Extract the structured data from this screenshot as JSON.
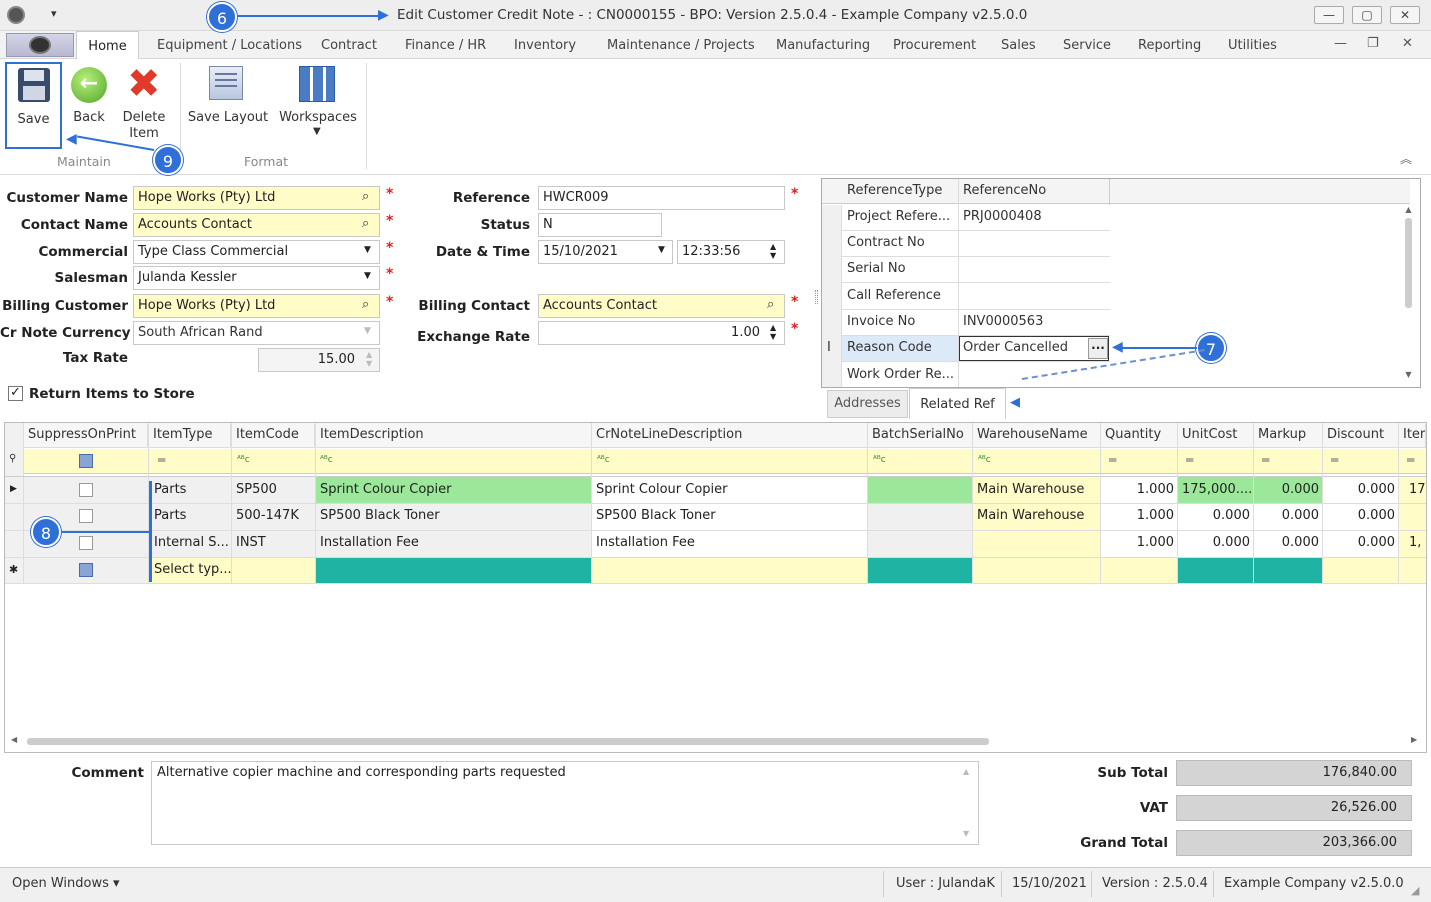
{
  "window": {
    "title": "Edit Customer Credit Note - : CN0000155 - BPO: Version 2.5.0.4 - Example Company v2.5.0.0",
    "min": "—",
    "max": "▢",
    "close": "✕"
  },
  "menu": {
    "tabs": [
      "Home",
      "Equipment / Locations",
      "Contract",
      "Finance / HR",
      "Inventory",
      "Maintenance / Projects",
      "Manufacturing",
      "Procurement",
      "Sales",
      "Service",
      "Reporting",
      "Utilities"
    ]
  },
  "ribbon": {
    "save": "Save",
    "back": "Back",
    "delete": "Delete Item",
    "save_layout": "Save Layout",
    "workspaces": "Workspaces",
    "group_maintain": "Maintain",
    "group_format": "Format"
  },
  "form": {
    "customer_name_label": "Customer Name",
    "customer_name": "Hope Works (Pty) Ltd",
    "contact_name_label": "Contact Name",
    "contact_name": "Accounts Contact",
    "commercial_label": "Commercial",
    "commercial": "Type Class Commercial",
    "salesman_label": "Salesman",
    "salesman": "Julanda Kessler",
    "billing_customer_label": "Billing Customer",
    "billing_customer": "Hope Works (Pty) Ltd",
    "currency_label": "Cr Note Currency",
    "currency": "South African Rand",
    "tax_rate_label": "Tax Rate",
    "tax_rate": "15.00",
    "return_items_label": "Return Items to Store",
    "reference_label": "Reference",
    "reference": "HWCR009",
    "status_label": "Status",
    "status": "N",
    "datetime_label": "Date & Time",
    "date": "15/10/2021",
    "time": "12:33:56",
    "billing_contact_label": "Billing Contact",
    "billing_contact": "Accounts Contact",
    "exchange_rate_label": "Exchange Rate",
    "exchange_rate": "1.00"
  },
  "ref_grid": {
    "col1": "ReferenceType",
    "col2": "ReferenceNo",
    "rows": [
      {
        "type": "Project Refere...",
        "no": "PRJ0000408"
      },
      {
        "type": "Contract No",
        "no": ""
      },
      {
        "type": "Serial No",
        "no": ""
      },
      {
        "type": "Call Reference",
        "no": ""
      },
      {
        "type": "Invoice No",
        "no": "INV0000563"
      },
      {
        "type": "Reason Code",
        "no": "Order Cancelled"
      },
      {
        "type": "Work Order Re...",
        "no": ""
      }
    ],
    "tab_addresses": "Addresses",
    "tab_related": "Related Ref",
    "ellipsis": "···"
  },
  "badges": {
    "b6": "6",
    "b7": "7",
    "b8": "8",
    "b9": "9"
  },
  "lines": {
    "headers": [
      "SuppressOnPrint",
      "ItemType",
      "ItemCode",
      "ItemDescription",
      "CrNoteLineDescription",
      "BatchSerialNo",
      "WarehouseName",
      "Quantity",
      "UnitCost",
      "Markup",
      "Discount",
      "Iter"
    ],
    "rows": [
      {
        "type": "Parts",
        "code": "SP500",
        "desc": "Sprint Colour Copier",
        "crdesc": "Sprint Colour Copier",
        "batch": "",
        "wh": "Main Warehouse",
        "qty": "1.000",
        "cost": "175,000....",
        "markup": "0.000",
        "disc": "0.000",
        "iter": "17"
      },
      {
        "type": "Parts",
        "code": "500-147K",
        "desc": "SP500 Black Toner",
        "crdesc": "SP500 Black Toner",
        "batch": "",
        "wh": "Main Warehouse",
        "qty": "1.000",
        "cost": "0.000",
        "markup": "0.000",
        "disc": "0.000",
        "iter": ""
      },
      {
        "type": "Internal S...",
        "code": "INST",
        "desc": "Installation Fee",
        "crdesc": "Installation Fee",
        "batch": "",
        "wh": "",
        "qty": "1.000",
        "cost": "0.000",
        "markup": "0.000",
        "disc": "0.000",
        "iter": "1,"
      }
    ],
    "new_row": "Select typ..."
  },
  "footer": {
    "comment_label": "Comment",
    "comment": "Alternative copier machine and corresponding parts requested",
    "subtotal_label": "Sub Total",
    "subtotal": "176,840.00",
    "vat_label": "VAT",
    "vat": "26,526.00",
    "grand_label": "Grand Total",
    "grand": "203,366.00"
  },
  "status": {
    "open_windows": "Open Windows ▾",
    "user": "User : JulandaK",
    "date": "15/10/2021",
    "version": "Version : 2.5.0.4",
    "company": "Example Company v2.5.0.0"
  },
  "colors": {
    "yellow": "#fffcc8",
    "green": "#9be89b",
    "teal": "#1fb3a3",
    "badge": "#2f6fd8"
  }
}
